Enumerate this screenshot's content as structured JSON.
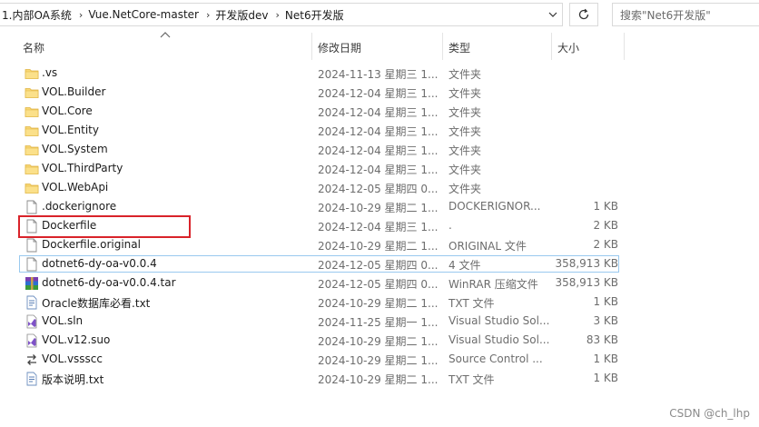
{
  "address": {
    "crumbs": [
      "1.内部OA系统",
      "Vue.NetCore-master",
      "开发版dev",
      "Net6开发版"
    ]
  },
  "search": {
    "placeholder": "搜索\"Net6开发版\""
  },
  "columns": {
    "name": "名称",
    "date": "修改日期",
    "type": "类型",
    "size": "大小"
  },
  "files": [
    {
      "name": ".vs",
      "date": "2024-11-13 星期三 1...",
      "type": "文件夹",
      "size": "",
      "icon": "folder-icon"
    },
    {
      "name": "VOL.Builder",
      "date": "2024-12-04 星期三 1...",
      "type": "文件夹",
      "size": "",
      "icon": "folder-icon"
    },
    {
      "name": "VOL.Core",
      "date": "2024-12-04 星期三 1...",
      "type": "文件夹",
      "size": "",
      "icon": "folder-icon"
    },
    {
      "name": "VOL.Entity",
      "date": "2024-12-04 星期三 1...",
      "type": "文件夹",
      "size": "",
      "icon": "folder-icon"
    },
    {
      "name": "VOL.System",
      "date": "2024-12-04 星期三 1...",
      "type": "文件夹",
      "size": "",
      "icon": "folder-icon"
    },
    {
      "name": "VOL.ThirdParty",
      "date": "2024-12-04 星期三 1...",
      "type": "文件夹",
      "size": "",
      "icon": "folder-icon"
    },
    {
      "name": "VOL.WebApi",
      "date": "2024-12-05 星期四 0...",
      "type": "文件夹",
      "size": "",
      "icon": "folder-icon"
    },
    {
      "name": ".dockerignore",
      "date": "2024-10-29 星期二 1...",
      "type": "DOCKERIGNOR...",
      "size": "1 KB",
      "icon": "file-icon"
    },
    {
      "name": "Dockerfile",
      "date": "2024-12-04 星期三 1...",
      "type": ".",
      "size": "2 KB",
      "icon": "file-icon"
    },
    {
      "name": "Dockerfile.original",
      "date": "2024-10-29 星期二 1...",
      "type": "ORIGINAL 文件",
      "size": "2 KB",
      "icon": "file-icon"
    },
    {
      "name": "dotnet6-dy-oa-v0.0.4",
      "date": "2024-12-05 星期四 0...",
      "type": "4 文件",
      "size": "358,913 KB",
      "icon": "file-icon",
      "selected": true
    },
    {
      "name": "dotnet6-dy-oa-v0.0.4.tar",
      "date": "2024-12-05 星期四 0...",
      "type": "WinRAR 压缩文件",
      "size": "358,913 KB",
      "icon": "winrar-icon"
    },
    {
      "name": "Oracle数据库必看.txt",
      "date": "2024-10-29 星期二 1...",
      "type": "TXT 文件",
      "size": "1 KB",
      "icon": "text-file-icon"
    },
    {
      "name": "VOL.sln",
      "date": "2024-11-25 星期一 1...",
      "type": "Visual Studio Sol...",
      "size": "3 KB",
      "icon": "visual-studio-icon"
    },
    {
      "name": "VOL.v12.suo",
      "date": "2024-10-29 星期二 1...",
      "type": "Visual Studio Sol...",
      "size": "83 KB",
      "icon": "visual-studio-icon"
    },
    {
      "name": "VOL.vssscc",
      "date": "2024-10-29 星期二 1...",
      "type": "Source Control ...",
      "size": "1 KB",
      "icon": "source-control-icon"
    },
    {
      "name": "版本说明.txt",
      "date": "2024-10-29 星期二 1...",
      "type": "TXT 文件",
      "size": "1 KB",
      "icon": "text-file-icon"
    }
  ],
  "watermark": "CSDN @ch_lhp"
}
